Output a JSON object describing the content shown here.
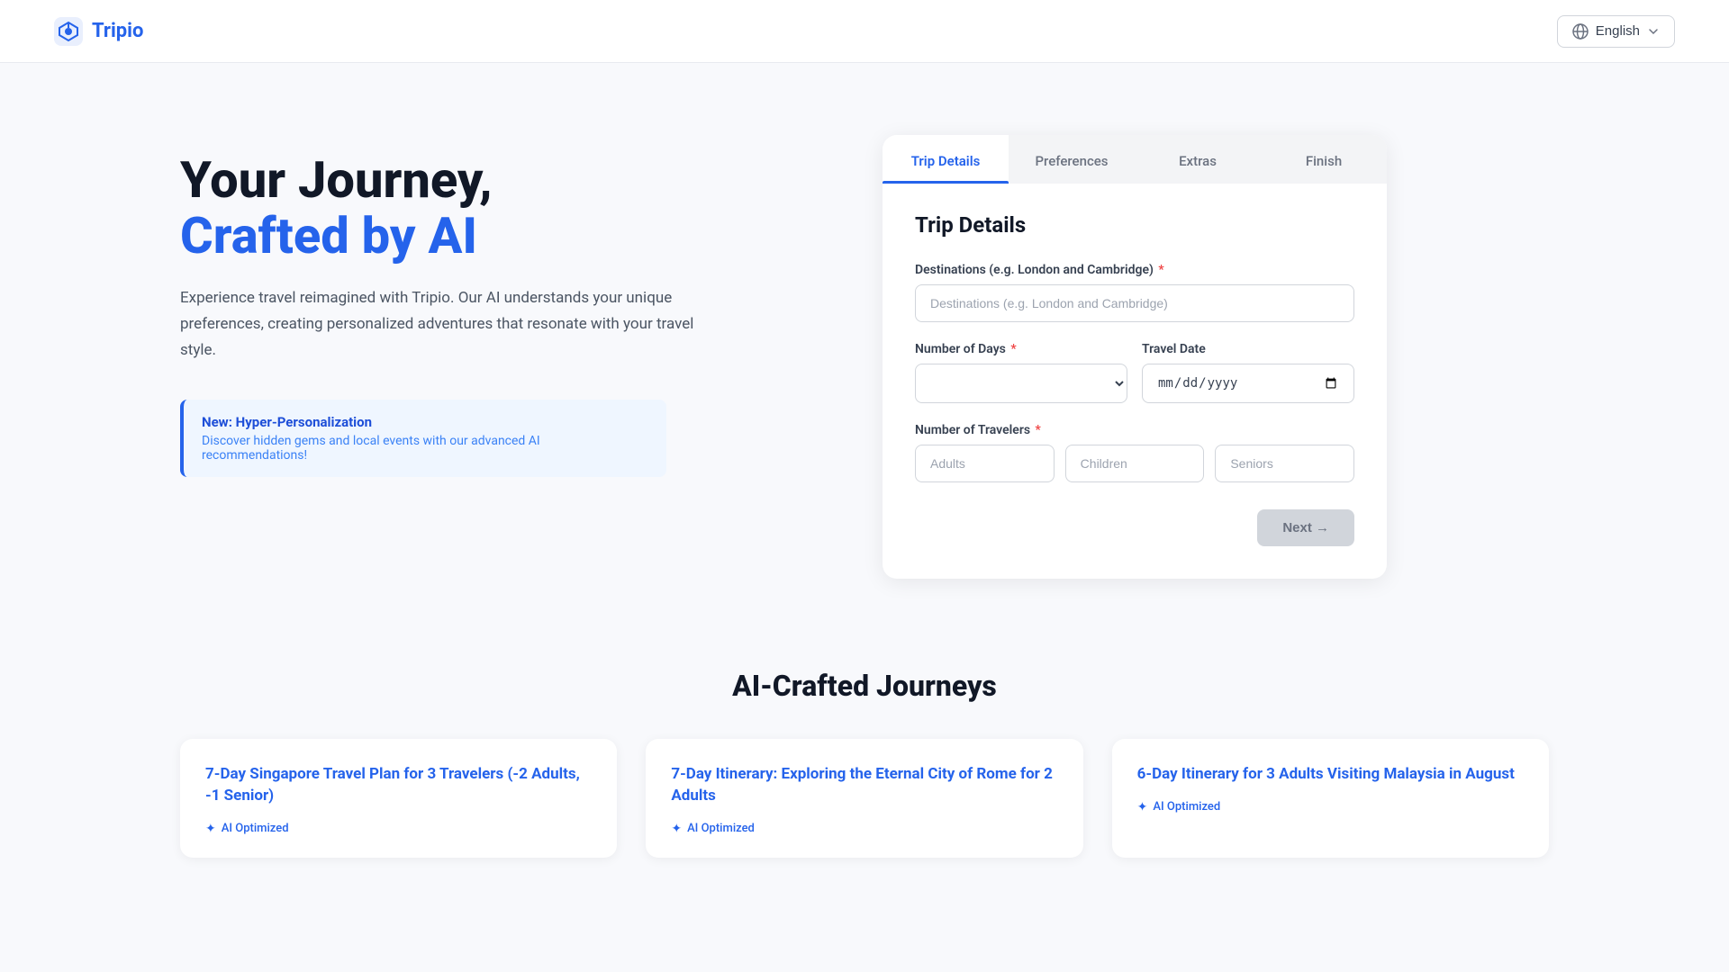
{
  "nav": {
    "logo_text": "Tripio",
    "lang_label": "English"
  },
  "hero": {
    "title_line1": "Your Journey,",
    "title_line2": "Crafted by AI",
    "description": "Experience travel reimagined with Tripio. Our AI understands your unique preferences, creating personalized adventures that resonate with your travel style.",
    "banner_title": "New: Hyper-Personalization",
    "banner_desc": "Discover hidden gems and local events with our advanced AI recommendations!"
  },
  "trip_form": {
    "card_title": "Trip Details",
    "tabs": [
      {
        "label": "Trip Details",
        "active": true
      },
      {
        "label": "Preferences",
        "active": false
      },
      {
        "label": "Extras",
        "active": false
      },
      {
        "label": "Finish",
        "active": false
      }
    ],
    "destinations_label": "Destinations (e.g. London and Cambridge)",
    "destinations_placeholder": "Destinations (e.g. London and Cambridge)",
    "days_label": "Number of Days",
    "date_label": "Travel Date",
    "date_placeholder": "mm/dd/yyyy",
    "travelers_label": "Number of Travelers",
    "adults_placeholder": "Adults",
    "children_placeholder": "Children",
    "seniors_placeholder": "Seniors",
    "next_button": "Next →"
  },
  "ai_journeys": {
    "section_title": "AI-Crafted Journeys",
    "cards": [
      {
        "title": "7-Day Singapore Travel Plan for 3 Travelers (-2 Adults, -1 Senior)",
        "badge": "AI Optimized"
      },
      {
        "title": "7-Day Itinerary: Exploring the Eternal City of Rome for 2 Adults",
        "badge": "AI Optimized"
      },
      {
        "title": "6-Day Itinerary for 3 Adults Visiting Malaysia in August",
        "badge": "AI Optimized"
      }
    ]
  }
}
